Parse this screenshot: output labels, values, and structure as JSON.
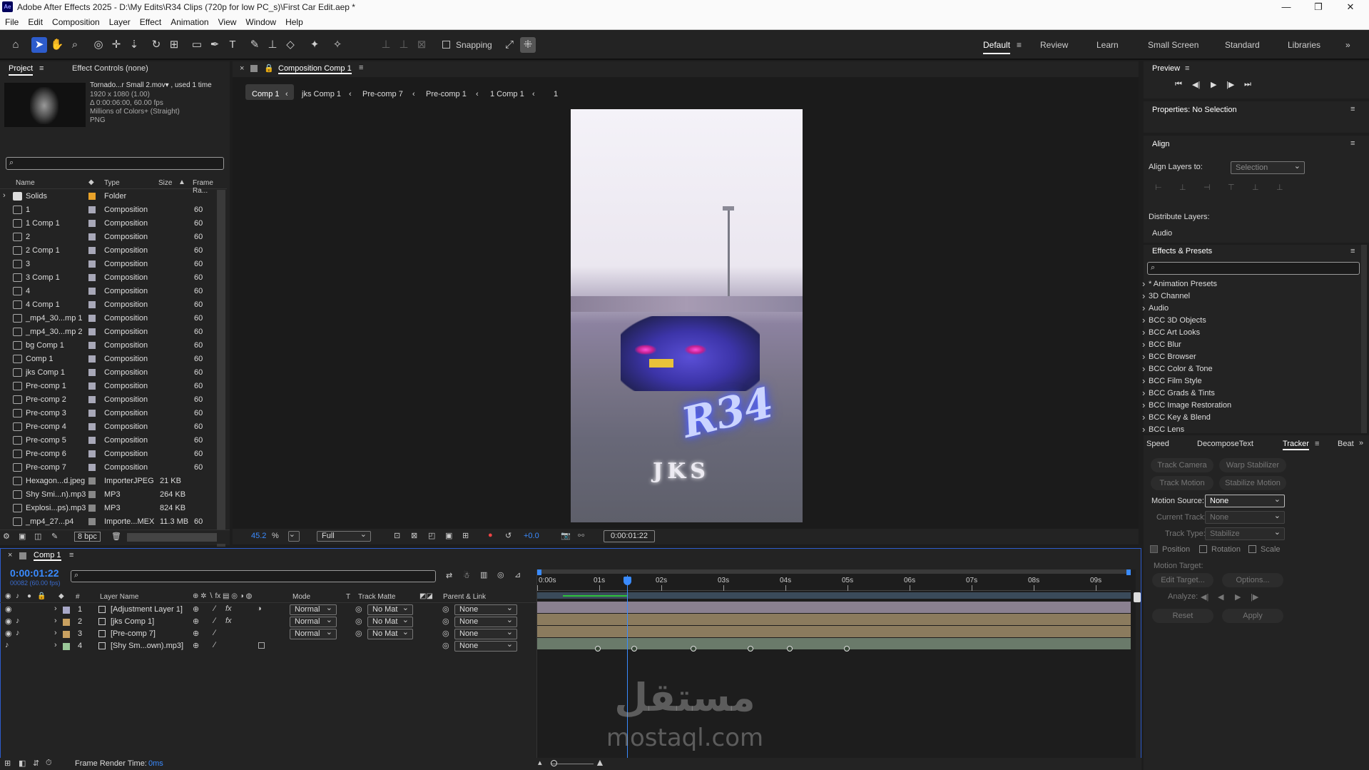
{
  "window": {
    "title": "Adobe After Effects 2025 - D:\\My Edits\\R34 Clips (720p for low PC_s)\\First Car Edit.aep *",
    "logo": "Ae"
  },
  "menu": [
    "File",
    "Edit",
    "Composition",
    "Layer",
    "Effect",
    "Animation",
    "View",
    "Window",
    "Help"
  ],
  "toolbar": {
    "snapping": "Snapping",
    "workspaces": [
      "Default",
      "Review",
      "Learn",
      "Small Screen",
      "Standard",
      "Libraries"
    ]
  },
  "project": {
    "tab": "Project",
    "effect_controls": "Effect Controls (none)",
    "info": [
      "Tornado...r Small 2.mov▾ , used 1 time",
      "1920 x 1080 (1.00)",
      "Δ 0:00:06:00, 60.00 fps",
      "Millions of Colors+ (Straight)",
      "PNG"
    ],
    "columns": {
      "name": "Name",
      "type": "Type",
      "size": "Size",
      "frame": "Frame Ra..."
    },
    "items": [
      {
        "name": "Solids",
        "type": "Folder",
        "size": "",
        "frame": ""
      },
      {
        "name": "1",
        "type": "Composition",
        "size": "",
        "frame": "60"
      },
      {
        "name": "1 Comp 1",
        "type": "Composition",
        "size": "",
        "frame": "60"
      },
      {
        "name": "2",
        "type": "Composition",
        "size": "",
        "frame": "60"
      },
      {
        "name": "2 Comp 1",
        "type": "Composition",
        "size": "",
        "frame": "60"
      },
      {
        "name": "3",
        "type": "Composition",
        "size": "",
        "frame": "60"
      },
      {
        "name": "3 Comp 1",
        "type": "Composition",
        "size": "",
        "frame": "60"
      },
      {
        "name": "4",
        "type": "Composition",
        "size": "",
        "frame": "60"
      },
      {
        "name": "4 Comp 1",
        "type": "Composition",
        "size": "",
        "frame": "60"
      },
      {
        "name": "_mp4_30...mp 1",
        "type": "Composition",
        "size": "",
        "frame": "60"
      },
      {
        "name": "_mp4_30...mp 2",
        "type": "Composition",
        "size": "",
        "frame": "60"
      },
      {
        "name": "bg Comp 1",
        "type": "Composition",
        "size": "",
        "frame": "60"
      },
      {
        "name": "Comp 1",
        "type": "Composition",
        "size": "",
        "frame": "60"
      },
      {
        "name": "jks Comp 1",
        "type": "Composition",
        "size": "",
        "frame": "60"
      },
      {
        "name": "Pre-comp 1",
        "type": "Composition",
        "size": "",
        "frame": "60"
      },
      {
        "name": "Pre-comp 2",
        "type": "Composition",
        "size": "",
        "frame": "60"
      },
      {
        "name": "Pre-comp 3",
        "type": "Composition",
        "size": "",
        "frame": "60"
      },
      {
        "name": "Pre-comp 4",
        "type": "Composition",
        "size": "",
        "frame": "60"
      },
      {
        "name": "Pre-comp 5",
        "type": "Composition",
        "size": "",
        "frame": "60"
      },
      {
        "name": "Pre-comp 6",
        "type": "Composition",
        "size": "",
        "frame": "60"
      },
      {
        "name": "Pre-comp 7",
        "type": "Composition",
        "size": "",
        "frame": "60"
      },
      {
        "name": "Hexagon...d.jpeg",
        "type": "ImporterJPEG",
        "size": "21 KB",
        "frame": ""
      },
      {
        "name": "Shy Smi...n).mp3",
        "type": "MP3",
        "size": "264 KB",
        "frame": ""
      },
      {
        "name": "Explosi...ps).mp3",
        "type": "MP3",
        "size": "824 KB",
        "frame": ""
      },
      {
        "name": "_mp4_27...p4",
        "type": "Importe...MEX",
        "size": "11.3 MB",
        "frame": "60"
      }
    ],
    "bpc": "8 bpc"
  },
  "composition": {
    "tab": "Composition Comp 1",
    "breadcrumbs": [
      "Comp 1",
      "jks Comp 1",
      "Pre-comp 7",
      "Pre-comp 1",
      "1 Comp 1",
      "1"
    ],
    "zoom": "45.2",
    "zoom_unit": "%",
    "resolution": "Full",
    "exposure": "+0.0",
    "timecode": "0:00:01:22",
    "overlay_title": "R34",
    "overlay_sub": "JKS"
  },
  "timeline": {
    "tab": "Comp 1",
    "timecode": "0:00:01:22",
    "frame_info": "00082 (60.00 fps)",
    "headers": {
      "num": "#",
      "layer": "Layer Name",
      "mode": "Mode",
      "t": "T",
      "matte": "Track Matte",
      "parent": "Parent & Link"
    },
    "ruler": [
      "0:00s",
      "01s",
      "02s",
      "03s",
      "04s",
      "05s",
      "06s",
      "07s",
      "08s",
      "09s"
    ],
    "layers": [
      {
        "num": "1",
        "name": "[Adjustment Layer 1]",
        "mode": "Normal",
        "matte": "No Mat",
        "parent": "None"
      },
      {
        "num": "2",
        "name": "[jks Comp 1]",
        "mode": "Normal",
        "matte": "No Mat",
        "parent": "None"
      },
      {
        "num": "3",
        "name": "[Pre-comp 7]",
        "mode": "Normal",
        "matte": "No Mat",
        "parent": "None"
      },
      {
        "num": "4",
        "name": "[Shy Sm...own).mp3]",
        "mode": "",
        "matte": "",
        "parent": "None"
      }
    ],
    "render_time_label": "Frame Render Time:",
    "render_time": "0ms",
    "playhead_progress": 0.152
  },
  "preview": {
    "title": "Preview"
  },
  "properties": {
    "title": "Properties: No Selection"
  },
  "align": {
    "title": "Align",
    "align_to_label": "Align Layers to:",
    "align_to": "Selection",
    "distribute": "Distribute Layers:",
    "audio": "Audio"
  },
  "effects": {
    "title": "Effects & Presets",
    "items": [
      "* Animation Presets",
      "3D Channel",
      "Audio",
      "BCC 3D Objects",
      "BCC Art Looks",
      "BCC Blur",
      "BCC Browser",
      "BCC Color & Tone",
      "BCC Film Style",
      "BCC Grads & Tints",
      "BCC Image Restoration",
      "BCC Key & Blend",
      "BCC Lens"
    ]
  },
  "tracker": {
    "tabs": [
      "Speed",
      "DecomposeText",
      "Tracker",
      "Beat"
    ],
    "track_camera": "Track Camera",
    "warp_stabilizer": "Warp Stabilizer",
    "track_motion": "Track Motion",
    "stabilize_motion": "Stabilize Motion",
    "motion_source_label": "Motion Source:",
    "motion_source": "None",
    "current_track_label": "Current Track:",
    "current_track": "None",
    "track_type_label": "Track Type:",
    "track_type": "Stabilize",
    "position": "Position",
    "rotation": "Rotation",
    "scale": "Scale",
    "motion_target": "Motion Target:",
    "edit_target": "Edit Target...",
    "options": "Options...",
    "analyze": "Analyze:",
    "reset": "Reset",
    "apply": "Apply"
  },
  "watermark": {
    "arabic": "مستقل",
    "latin": "mostaql.com"
  }
}
